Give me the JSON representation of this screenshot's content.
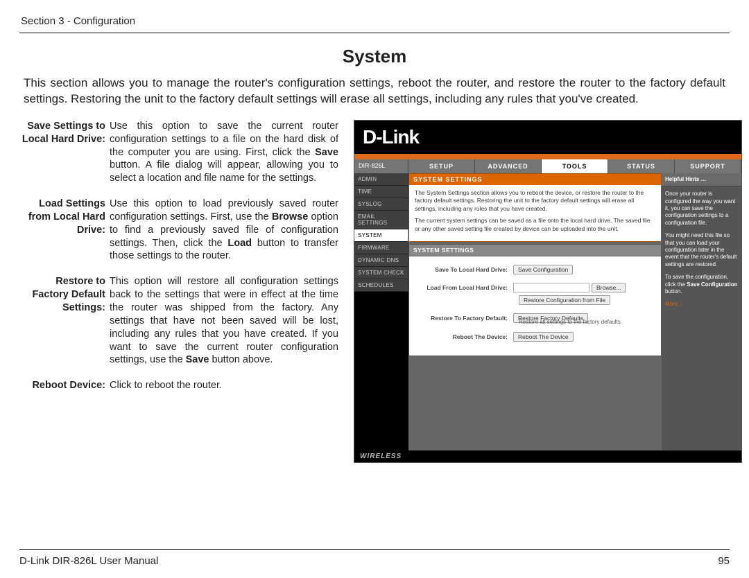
{
  "header": {
    "section": "Section 3 - Configuration"
  },
  "title": "System",
  "intro": "This section allows you to manage the router's configuration settings, reboot the router, and restore the router to the factory default settings. Restoring the unit to the factory default settings will erase all settings, including any rules that you've created.",
  "defs": {
    "save": {
      "label": "Save Settings to\nLocal Hard Drive:",
      "text_pre": "Use this option to save the current router configuration settings to a file on the hard disk of the computer you are using. First, click the ",
      "bold": "Save",
      "text_post": " button. A file dialog will appear, allowing you to select a location and file name for the settings."
    },
    "load": {
      "label": "Load Settings\nfrom Local Hard\nDrive:",
      "text_pre": "Use this option to load previously saved router configuration settings. First, use the ",
      "bold1": "Browse",
      "mid": " option to find a previously saved file of configuration settings. Then, click the ",
      "bold2": "Load",
      "text_post": " button to transfer those settings to the router."
    },
    "restore": {
      "label": "Restore to\nFactory Default\nSettings:",
      "text_pre": "This option will restore all configuration settings back to the settings that were in effect at the time the router was shipped from the factory. Any settings that have not been saved will be lost, including any rules that you have created. If you want to save the current router configuration settings, use the ",
      "bold": "Save",
      "text_post": " button above."
    },
    "reboot": {
      "label": "Reboot Device:",
      "text": "Click to reboot the router."
    }
  },
  "router": {
    "brand": "D-Link",
    "product": "DIR-826L",
    "tabs": {
      "setup": "SETUP",
      "advanced": "ADVANCED",
      "tools": "TOOLS",
      "status": "STATUS",
      "support": "SUPPORT"
    },
    "side": {
      "admin": "ADMIN",
      "time": "TIME",
      "syslog": "SYSLOG",
      "email": "EMAIL SETTINGS",
      "system": "SYSTEM",
      "firmware": "FIRMWARE",
      "ddns": "DYNAMIC DNS",
      "syscheck": "SYSTEM CHECK",
      "schedules": "SCHEDULES"
    },
    "panel": {
      "title": "SYSTEM SETTINGS",
      "desc1": "The System Settings section allows you to reboot the device, or restore the router to the factory default settings. Restoring the unit to the factory default settings will erase all settings, including any rules that you have created.",
      "desc2": "The current system settings can be saved as a file onto the local hard drive. The saved file or any other saved setting file created by device can be uploaded into the unit.",
      "section_title": "SYSTEM SETTINGS",
      "save_label": "Save To Local Hard Drive:",
      "save_btn": "Save Configuration",
      "load_label": "Load From Local Hard Drive:",
      "browse_btn": "Browse...",
      "restore_conf_btn": "Restore Configuration from File",
      "restore_label": "Restore To Factory Default:",
      "restore_btn": "Restore Factory Defaults",
      "restore_note": "Restore all settings to the factory defaults.",
      "reboot_label": "Reboot The Device:",
      "reboot_btn": "Reboot The Device"
    },
    "hints": {
      "title": "Helpful Hints …",
      "p1": "Once your router is configured the way you want it, you can save the configuration settings to a configuration file.",
      "p2_a": "You might need this file so that you can load your configuration later in the event that the router's default settings are restored.",
      "p3_a": "To save the configuration, click the ",
      "p3_bold": "Save Configuration",
      "p3_b": " button.",
      "more": "More…"
    },
    "wireless": "WIRELESS"
  },
  "footer": {
    "left": "D-Link DIR-826L User Manual",
    "right": "95"
  }
}
